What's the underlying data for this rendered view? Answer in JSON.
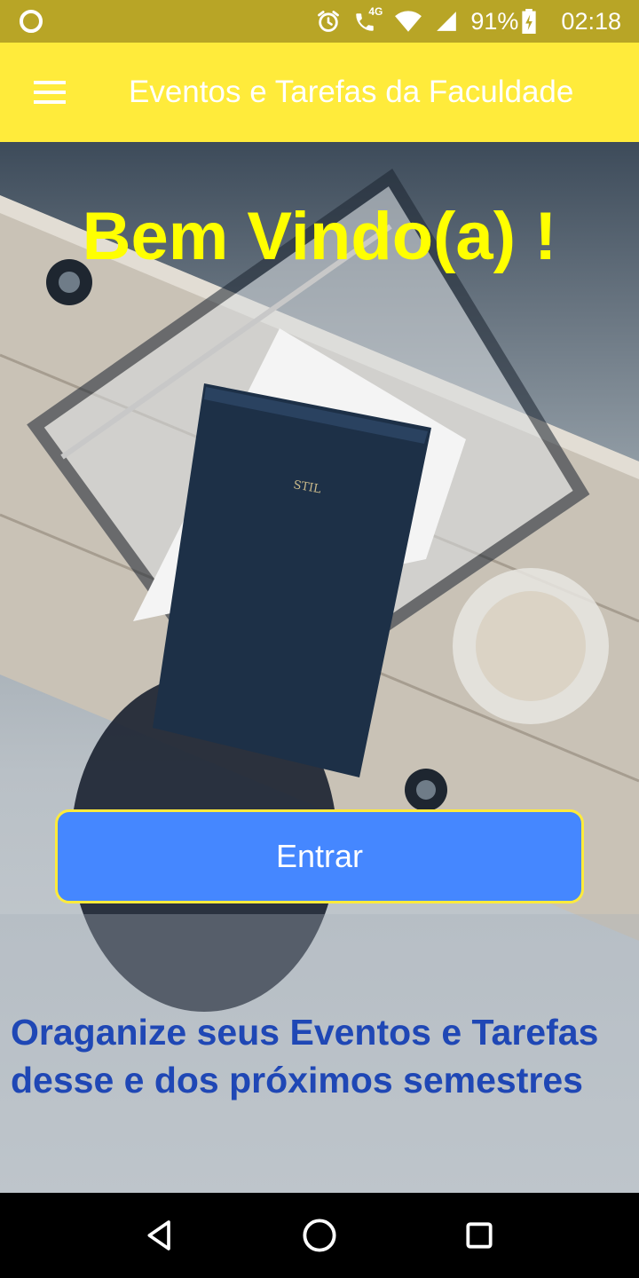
{
  "status_bar": {
    "network": "4G",
    "battery": "91%",
    "time": "02:18",
    "icons": [
      "notification-dot-icon",
      "alarm-icon",
      "volte-call-icon",
      "wifi-icon",
      "signal-icon",
      "battery-charging-icon"
    ]
  },
  "app_bar": {
    "title": "Eventos e Tarefas da Faculdade",
    "menu_icon": "hamburger-menu-icon",
    "background_color": "#ffeb3b"
  },
  "main": {
    "welcome": "Bem Vindo(a) !",
    "enter_button": "Entrar",
    "tagline": "Oraganize seus Eventos e Tarefas desse e dos próximos semestres",
    "welcome_color": "#ffff00",
    "button_color": "#4587ff",
    "tagline_color": "#1f47b5"
  },
  "nav_bar": {
    "buttons": [
      "back-icon",
      "home-icon",
      "recents-icon"
    ]
  }
}
